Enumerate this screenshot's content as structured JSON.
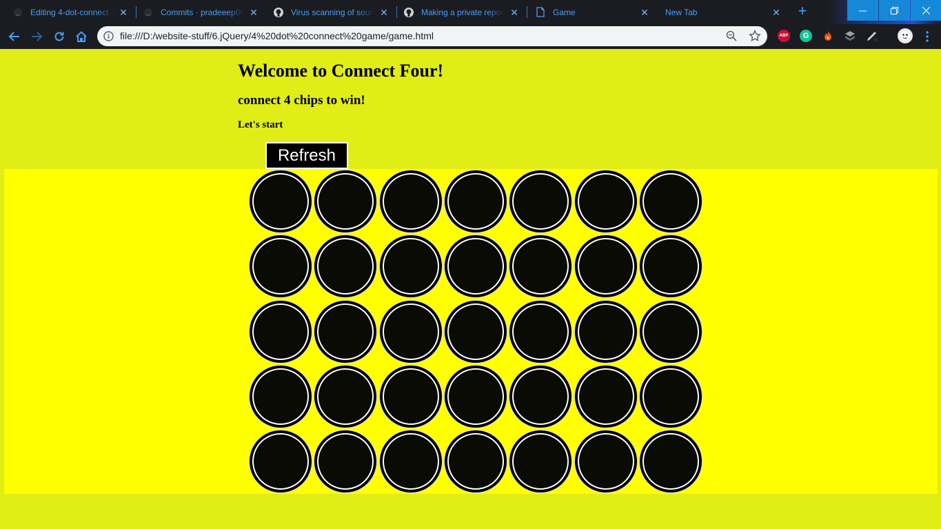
{
  "browser": {
    "tabs": [
      {
        "title": "Editing 4-dot-connect-g",
        "favicon": "github-dark-icon"
      },
      {
        "title": "Commits · pradeeep007",
        "favicon": "github-dark-icon"
      },
      {
        "title": "Virus scanning of sourc",
        "favicon": "github-icon"
      },
      {
        "title": "Making a private reposi",
        "favicon": "github-icon"
      },
      {
        "title": "Game",
        "favicon": "document-icon",
        "active": true
      },
      {
        "title": "New Tab",
        "favicon": "none"
      }
    ],
    "address_bar": {
      "url": "file:///D:/website-stuff/6.jQuery/4%20dot%20connect%20game/game.html"
    },
    "extensions": [
      {
        "name": "abp-icon",
        "label": "ABP",
        "color": "#c8102e"
      },
      {
        "name": "grammarly-icon",
        "label": "G",
        "color": "#15c39a"
      },
      {
        "name": "fire-icon",
        "label": "",
        "color": "#e8531c"
      },
      {
        "name": "layers-icon",
        "label": "",
        "color": "#9aa0a6"
      },
      {
        "name": "pen-icon",
        "label": "",
        "color": "#cfd3d6"
      }
    ],
    "accent_color": "#4a9ff5"
  },
  "page": {
    "heading": "Welcome to Connect Four!",
    "subheading": "connect 4 chips to win!",
    "prompt": "Let's start",
    "refresh_label": "Refresh",
    "background_color": "#e0ed17",
    "board_color": "#ffff00",
    "board": {
      "rows": 5,
      "cols": 7,
      "cell_color": "#000000"
    }
  }
}
